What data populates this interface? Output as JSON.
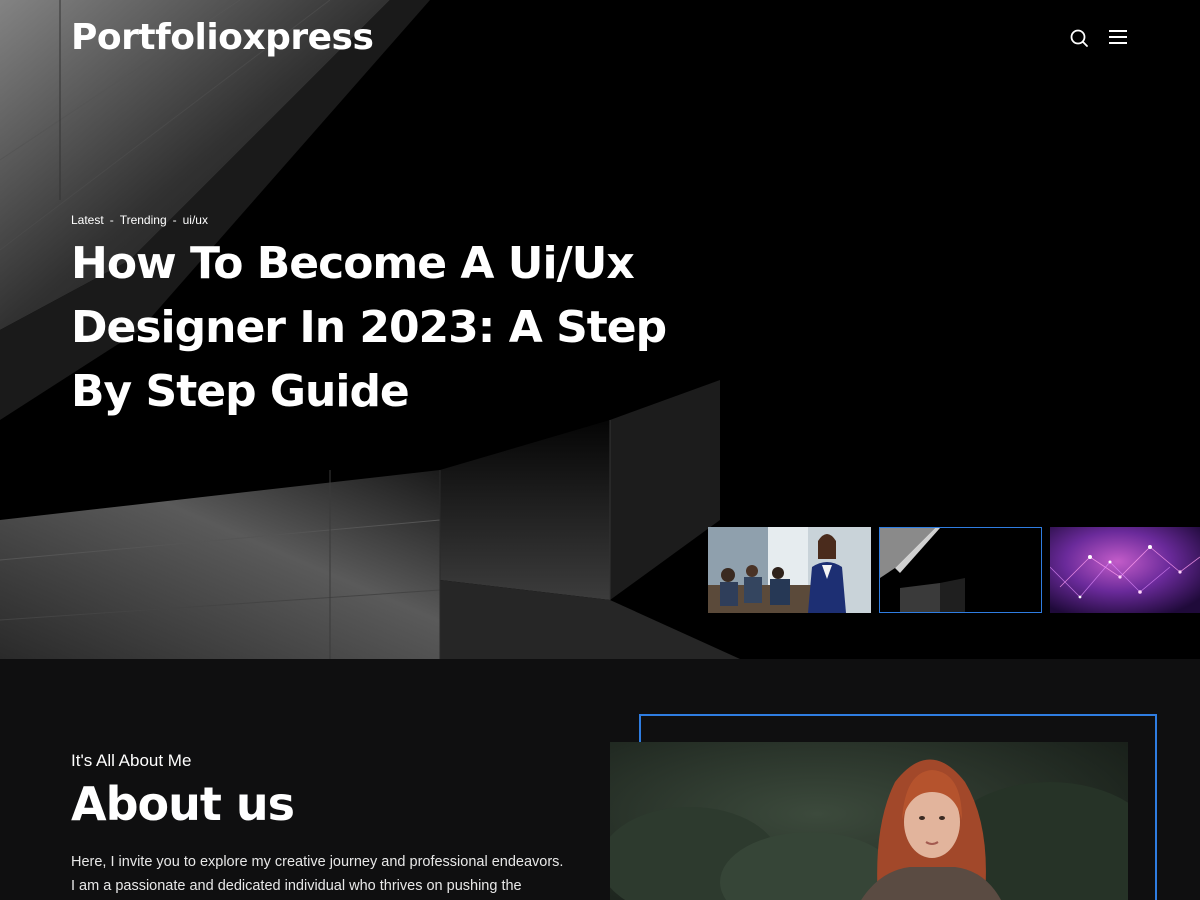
{
  "header": {
    "logo": "Portfolioxpress",
    "search_icon": "search-icon",
    "menu_icon": "hamburger-menu-icon"
  },
  "hero": {
    "breadcrumb": [
      "Latest",
      "Trending",
      "ui/ux"
    ],
    "breadcrumb_separator": "-",
    "title": "How To Become A Ui/Ux Designer In 2023: A Step By Step Guide",
    "active_thumbnail": 2,
    "accent_color": "#2f7de1"
  },
  "about": {
    "eyebrow": "It's All About Me",
    "title": "About us",
    "text_line_1": "Here, I invite you to explore my creative journey and professional endeavors.",
    "text_line_2": "I am a passionate and dedicated individual who thrives on pushing the"
  }
}
